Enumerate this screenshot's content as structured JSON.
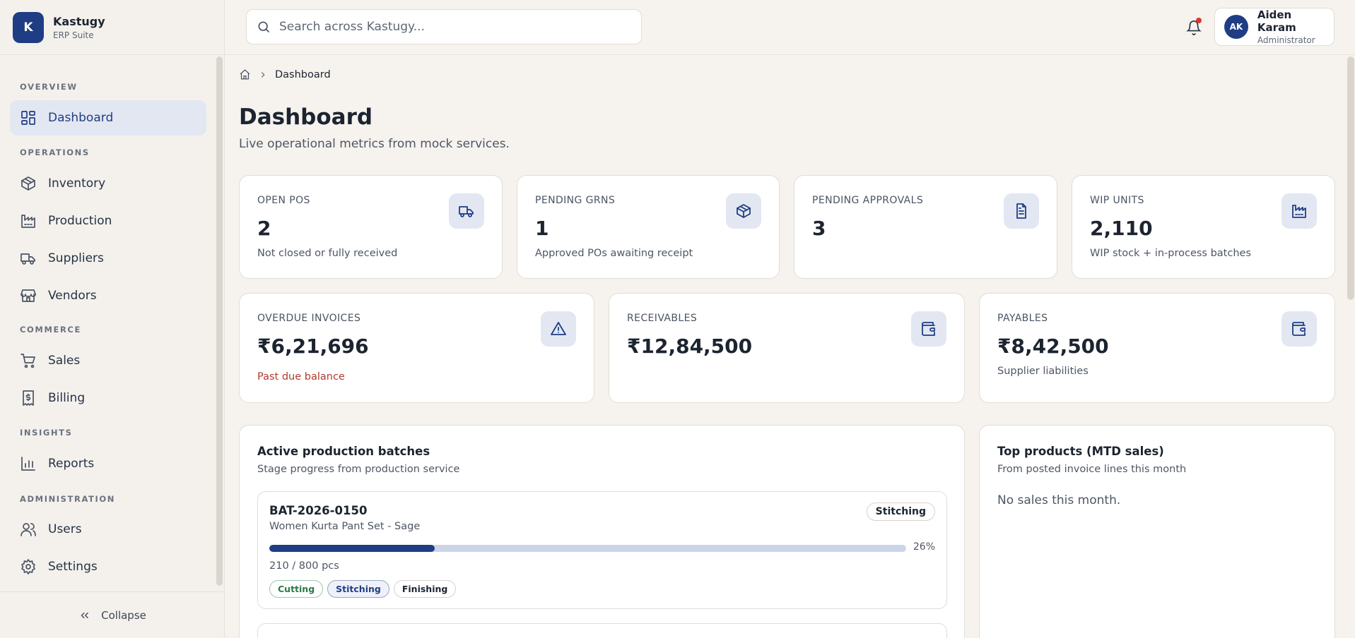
{
  "brand": {
    "logo_letter": "K",
    "name": "Kastugy",
    "subtitle": "ERP Suite"
  },
  "search": {
    "placeholder": "Search across Kastugy..."
  },
  "user": {
    "initials": "AK",
    "name": "Aiden Karam",
    "role": "Administrator"
  },
  "notifications": {
    "has_unread": true
  },
  "sidebar": {
    "sections": [
      "OVERVIEW",
      "OPERATIONS",
      "COMMERCE",
      "INSIGHTS",
      "ADMINISTRATION"
    ],
    "items": [
      {
        "label": "Dashboard",
        "icon": "dashboard-icon",
        "active": true
      },
      {
        "label": "Inventory",
        "icon": "box-icon"
      },
      {
        "label": "Production",
        "icon": "factory-icon"
      },
      {
        "label": "Suppliers",
        "icon": "truck-icon"
      },
      {
        "label": "Vendors",
        "icon": "store-icon"
      },
      {
        "label": "Sales",
        "icon": "cart-icon"
      },
      {
        "label": "Billing",
        "icon": "receipt-icon"
      },
      {
        "label": "Reports",
        "icon": "bar-chart-icon"
      },
      {
        "label": "Users",
        "icon": "users-icon"
      },
      {
        "label": "Settings",
        "icon": "gear-icon"
      }
    ],
    "collapse_label": "Collapse"
  },
  "breadcrumb": {
    "current": "Dashboard"
  },
  "page": {
    "title": "Dashboard",
    "subtitle": "Live operational metrics from mock services."
  },
  "kpis_row1": [
    {
      "label": "OPEN POS",
      "value": "2",
      "note": "Not closed or fully received",
      "icon": "truck-icon"
    },
    {
      "label": "PENDING GRNS",
      "value": "1",
      "note": "Approved POs awaiting receipt",
      "icon": "box-icon"
    },
    {
      "label": "PENDING APPROVALS",
      "value": "3",
      "note": "",
      "icon": "document-icon"
    },
    {
      "label": "WIP UNITS",
      "value": "2,110",
      "note": "WIP stock + in-process batches",
      "icon": "factory-icon"
    }
  ],
  "kpis_row2": [
    {
      "label": "OVERDUE INVOICES",
      "value": "₹6,21,696",
      "note": "Past due balance",
      "icon": "warning-icon",
      "note_color": "#b23a2d"
    },
    {
      "label": "RECEIVABLES",
      "value": "₹12,84,500",
      "note": "",
      "icon": "wallet-icon"
    },
    {
      "label": "PAYABLES",
      "value": "₹8,42,500",
      "note": "Supplier liabilities",
      "icon": "wallet-icon"
    }
  ],
  "production": {
    "title": "Active production batches",
    "subtitle": "Stage progress from production service",
    "batches": [
      {
        "id": "BAT-2026-0150",
        "product": "Women Kurta Pant Set - Sage",
        "stage": "Stitching",
        "progress": 0.26,
        "progress_label": "26%",
        "quantity": "210 / 800 pcs",
        "stages": [
          "Cutting",
          "Stitching",
          "Finishing"
        ]
      }
    ]
  },
  "top_products": {
    "title": "Top products (MTD sales)",
    "subtitle": "From posted invoice lines this month",
    "empty_text": "No sales this month."
  },
  "colors": {
    "accent": "#1f3d85",
    "danger": "#b23a2d",
    "success": "#2a7a45",
    "background": "#f6f3ee"
  }
}
